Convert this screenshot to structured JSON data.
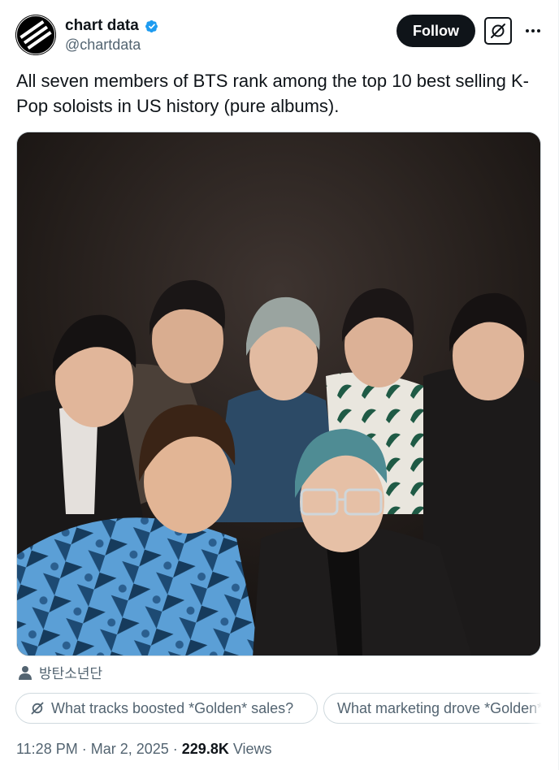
{
  "author": {
    "display_name": "chart data",
    "handle": "@chartdata",
    "verified": true,
    "avatar_icon": "chart-data-logo-icon",
    "verified_color": "#1d9bf0"
  },
  "actions": {
    "follow_label": "Follow",
    "grok_icon": "grok-icon",
    "more_icon": "more-dots-icon"
  },
  "tweet": {
    "text": "All seven members of BTS rank among the top 10 best selling K-Pop soloists in US history (pure albums)."
  },
  "media": {
    "tag_icon": "person-icon",
    "tagged_account": "방탄소년단"
  },
  "grok_suggestions": [
    {
      "label": "What tracks boosted *Golden* sales?",
      "icon": "grok-icon"
    },
    {
      "label": "What marketing drove *Golden* sales?"
    }
  ],
  "meta": {
    "time": "11:28 PM",
    "separator": " · ",
    "date": "Mar 2, 2025",
    "views_count": "229.8K",
    "views_label": "Views"
  },
  "colors": {
    "text_primary": "#0f1419",
    "text_secondary": "#536471",
    "border": "#cfd9de",
    "follow_bg": "#0f1419"
  }
}
